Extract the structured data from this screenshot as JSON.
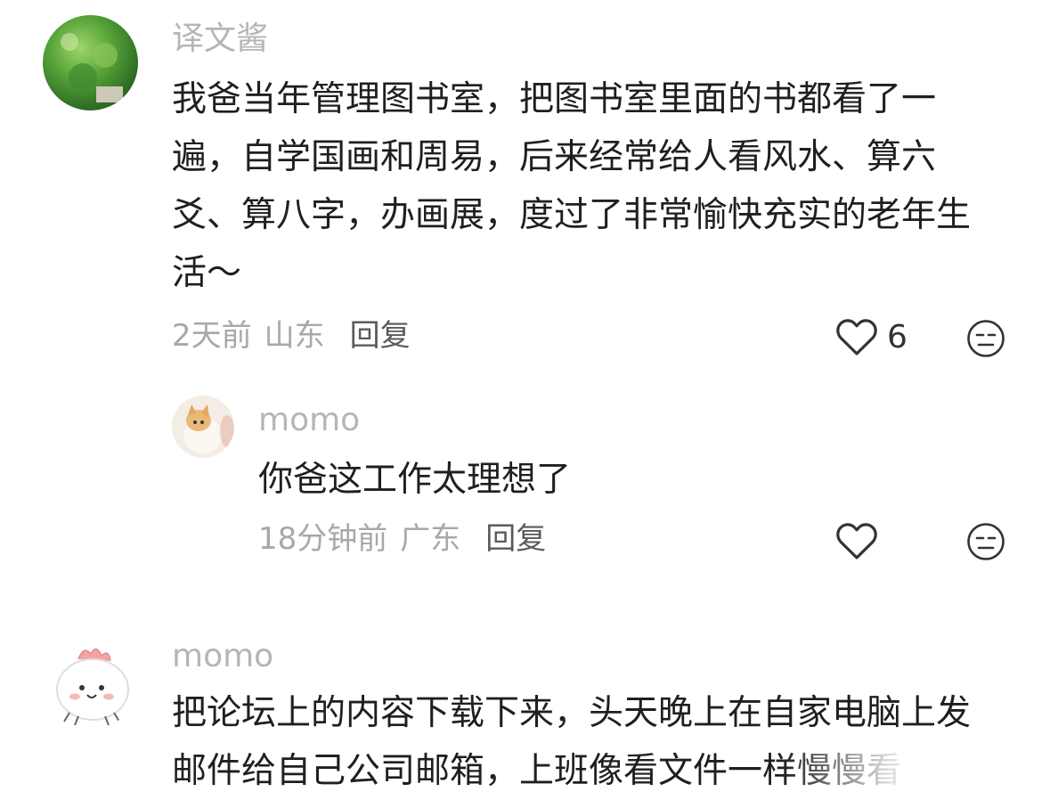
{
  "comments": [
    {
      "username": "译文酱",
      "text": "我爸当年管理图书室，把图书室里面的书都看了一遍，自学国画和周易，后来经常给人看风水、算六爻、算八字，办画展，度过了非常愉快充实的老年生活～",
      "time": "2天前",
      "location": "山东",
      "reply_label": "回复",
      "likes": "6",
      "avatar_icon": "landscape-plant-avatar"
    },
    {
      "username": "momo",
      "text": "你爸这工作太理想了",
      "time": "18分钟前",
      "location": "广东",
      "reply_label": "回复",
      "likes": "",
      "avatar_icon": "cat-avatar"
    },
    {
      "username": "momo",
      "text": "把论坛上的内容下载下来，头天晚上在自家电脑上发邮件给自己公司邮箱，上班像看文件一样慢慢看",
      "avatar_icon": "cute-chick-avatar"
    }
  ],
  "colors": {
    "username": "#b5b5b5",
    "meta": "#a8a8a8",
    "text": "#1f1f1f"
  }
}
